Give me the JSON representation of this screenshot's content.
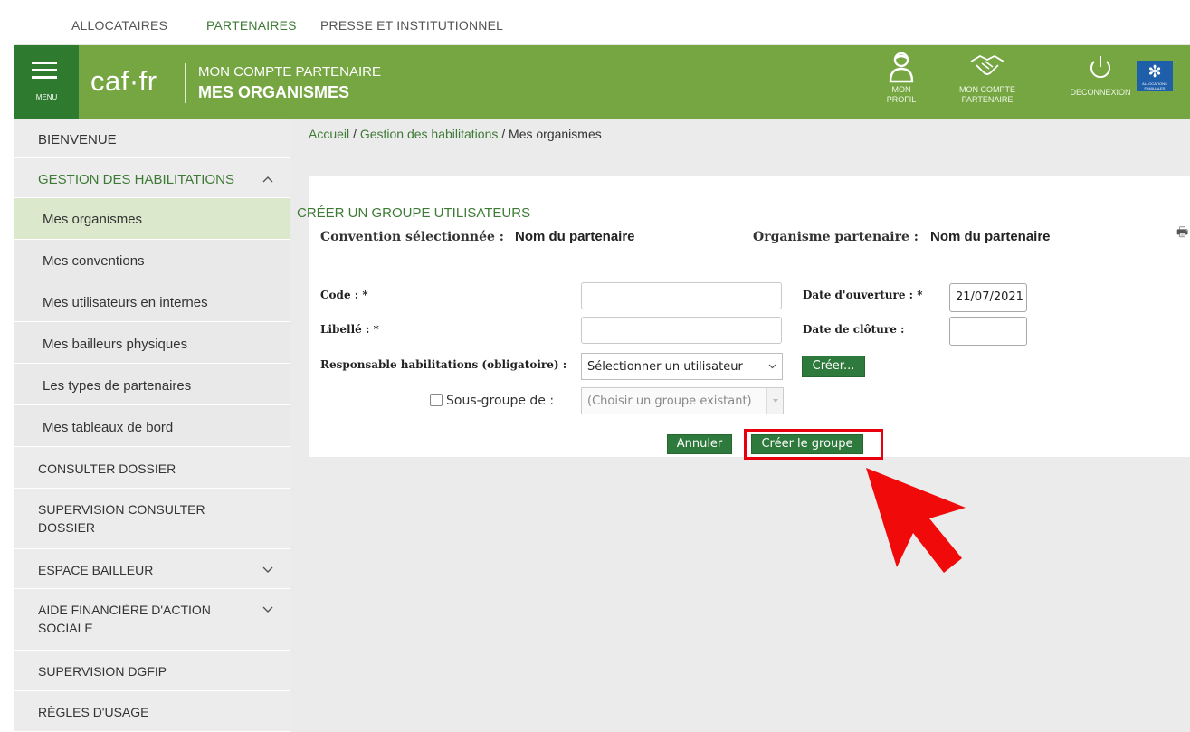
{
  "top_nav": {
    "links": [
      "ALLOCATAIRES",
      "PARTENAIRES",
      "PRESSE ET INSTITUTIONNEL"
    ],
    "active_index": 1
  },
  "header": {
    "menu_label": "MENU",
    "logo": "caf·fr",
    "line1": "MON COMPTE PARTENAIRE",
    "line2": "MES ORGANISMES",
    "actions": [
      {
        "icon": "user-profile-icon",
        "label": "MON PROFIL"
      },
      {
        "icon": "handshake-icon",
        "label": "MON COMPTE PARTENAIRE"
      },
      {
        "icon": "power-icon",
        "label": "DECONNEXION"
      }
    ],
    "badge_text": "ALLOCATIONS FAMILIALES",
    "colors": {
      "header_green": "#76a642",
      "menu_green": "#2e7a2e",
      "accent_green": "#3d7a35"
    }
  },
  "sidebar": {
    "items": [
      {
        "label": "BIENVENUE"
      },
      {
        "label": "GESTION DES HABILITATIONS",
        "expanded": true
      },
      {
        "label": "Mes organismes",
        "selected": true
      },
      {
        "label": "Mes conventions"
      },
      {
        "label": "Mes utilisateurs en internes"
      },
      {
        "label": "Mes bailleurs physiques"
      },
      {
        "label": "Les types de partenaires"
      },
      {
        "label": "Mes tableaux de bord"
      },
      {
        "label": "CONSULTER DOSSIER"
      },
      {
        "label": "SUPERVISION CONSULTER DOSSIER"
      },
      {
        "label": "ESPACE BAILLEUR",
        "expandable": true
      },
      {
        "label": "AIDE FINANCIÈRE D'ACTION SOCIALE",
        "expandable": true
      },
      {
        "label": "SUPERVISION DGFIP"
      },
      {
        "label": "RÈGLES D'USAGE"
      }
    ]
  },
  "breadcrumb": {
    "items": [
      "Accueil",
      "Gestion des habilitations",
      "Mes organismes"
    ],
    "separator": " / "
  },
  "form": {
    "title": "CRÉER UN GROUPE UTILISATEURS",
    "convention_label": "Convention sélectionnée :",
    "convention_value": "Nom du partenaire",
    "organisme_label": "Organisme partenaire :",
    "organisme_value": "Nom du partenaire",
    "code_label": "Code : *",
    "code_value": "",
    "libelle_label": "Libellé : *",
    "libelle_value": "",
    "date_ouverture_label": "Date d'ouverture : *",
    "date_ouverture_value": "21/07/2021",
    "date_cloture_label": "Date de clôture :",
    "date_cloture_value": "",
    "responsable_label": "Responsable habilitations (obligatoire) :",
    "responsable_value": "Sélectionner un utilisateur",
    "creer_label": "Créer...",
    "sous_groupe_label": "Sous-groupe de :",
    "sous_groupe_checked": false,
    "sous_groupe_placeholder": "(Choisir un groupe existant)",
    "annuler_label": "Annuler",
    "submit_label": "Créer le groupe"
  },
  "annotation": {
    "color": "#e8000d"
  }
}
